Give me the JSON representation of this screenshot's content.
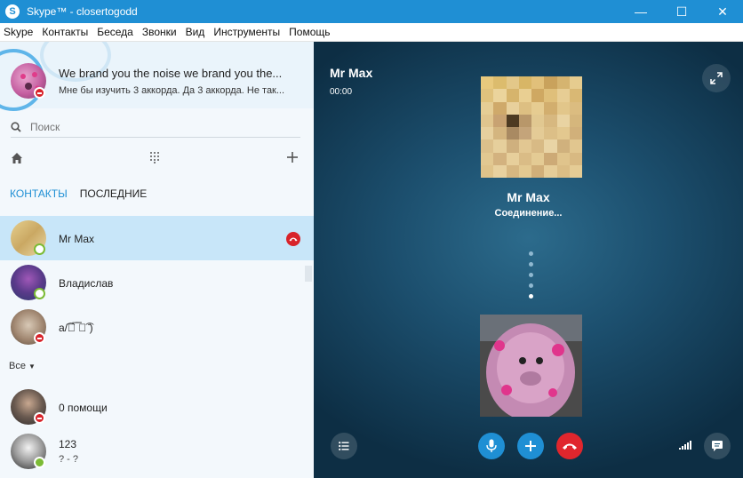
{
  "window": {
    "title": "Skype™ - closertogodd",
    "minimize": "—",
    "maximize": "☐",
    "close": "✕"
  },
  "menu": [
    "Skype",
    "Контакты",
    "Беседа",
    "Звонки",
    "Вид",
    "Инструменты",
    "Помощь"
  ],
  "profile": {
    "status_text": "We brand you the noise we brand you the...",
    "mood_text": "Мне бы изучить 3 аккорда. Да 3 аккорда. Не так..."
  },
  "search": {
    "placeholder": "Поиск"
  },
  "tabs": {
    "contacts": "КОНТАКТЫ",
    "recent": "ПОСЛЕДНИЕ"
  },
  "contacts": [
    {
      "name": "Mr Max",
      "presence": "online"
    },
    {
      "name": "Владислав",
      "presence": "online"
    },
    {
      "name": "а/͡ﾟ̅ ̅̅ﾟ͡ ̄)",
      "presence": "busy"
    }
  ],
  "group_label": "Все",
  "contacts_all": [
    {
      "name": "0 помощи",
      "presence": "busy"
    },
    {
      "name": "123",
      "mood": "? - ?",
      "presence": "online"
    }
  ],
  "call": {
    "name": "Mr Max",
    "timer": "00:00",
    "callee_name": "Mr Max",
    "status": "Соединение..."
  },
  "colors": {
    "accent": "#1f8fd4",
    "hangup": "#e0262d",
    "call_button": "#1f8fd4",
    "busy": "#d8232a",
    "online": "#7cbb35"
  }
}
